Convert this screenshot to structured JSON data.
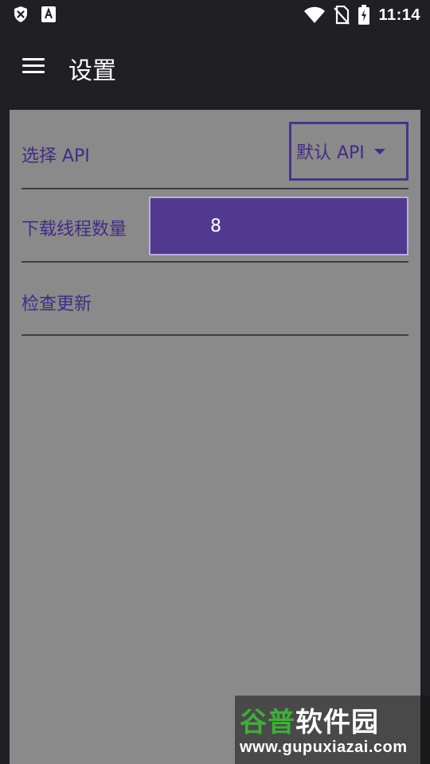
{
  "status_bar": {
    "time": "11:14",
    "icons": [
      "shield-icon",
      "font-icon",
      "wifi-icon",
      "no-sim-icon",
      "battery-icon"
    ]
  },
  "app_bar": {
    "title": "设置",
    "menu_icon": "menu-icon"
  },
  "settings": {
    "api": {
      "label": "选择 API",
      "selected": "默认 API"
    },
    "threads": {
      "label": "下载线程数量",
      "value": "8"
    },
    "update": {
      "label": "检查更新"
    }
  },
  "watermark": {
    "title_part1": "谷普",
    "title_part2": "软件园",
    "url": "www.gupuxiazai.com"
  },
  "colors": {
    "background": "#1f1f24",
    "panel": "#8a8a8a",
    "accent": "#50398e",
    "label_text": "#3f2d86"
  }
}
